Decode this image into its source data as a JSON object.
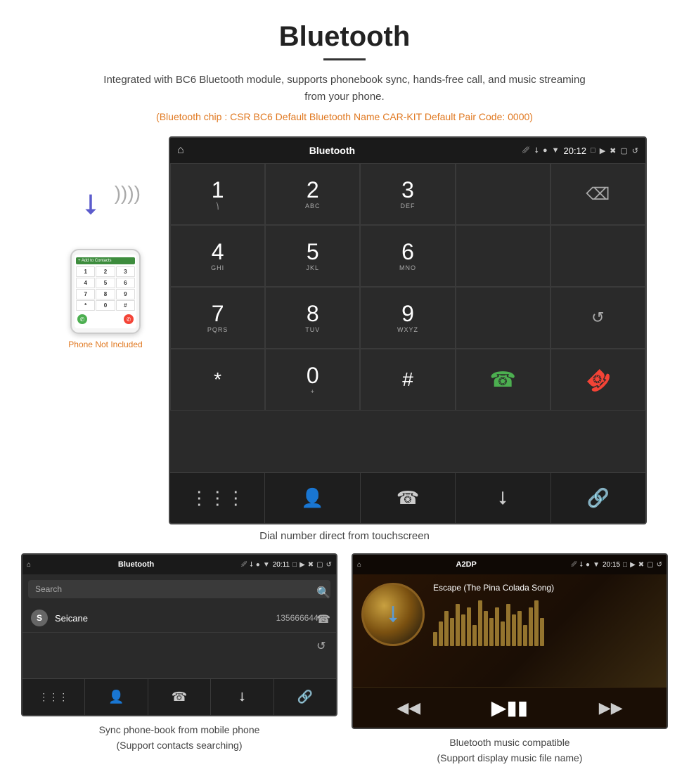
{
  "page": {
    "title": "Bluetooth",
    "description": "Integrated with BC6 Bluetooth module, supports phonebook sync, hands-free call, and music streaming from your phone.",
    "spec_line": "(Bluetooth chip : CSR BC6    Default Bluetooth Name CAR-KIT    Default Pair Code: 0000)",
    "dial_caption": "Dial number direct from touchscreen",
    "phonebook_caption_line1": "Sync phone-book from mobile phone",
    "phonebook_caption_line2": "(Support contacts searching)",
    "music_caption_line1": "Bluetooth music compatible",
    "music_caption_line2": "(Support display music file name)"
  },
  "dial_screen": {
    "status_title": "Bluetooth",
    "status_time": "20:12",
    "status_usb": "ψ",
    "keys": [
      {
        "main": "1",
        "sub": "⌓"
      },
      {
        "main": "2",
        "sub": "ABC"
      },
      {
        "main": "3",
        "sub": "DEF"
      },
      {
        "main": "",
        "sub": ""
      },
      {
        "main": "⌫",
        "sub": ""
      },
      {
        "main": "4",
        "sub": "GHI"
      },
      {
        "main": "5",
        "sub": "JKL"
      },
      {
        "main": "6",
        "sub": "MNO"
      },
      {
        "main": "",
        "sub": ""
      },
      {
        "main": "",
        "sub": ""
      },
      {
        "main": "7",
        "sub": "PQRS"
      },
      {
        "main": "8",
        "sub": "TUV"
      },
      {
        "main": "9",
        "sub": "WXYZ"
      },
      {
        "main": "",
        "sub": ""
      },
      {
        "main": "↺",
        "sub": ""
      },
      {
        "main": "*",
        "sub": ""
      },
      {
        "main": "0",
        "sub": "+"
      },
      {
        "main": "#",
        "sub": ""
      },
      {
        "main": "📞",
        "sub": ""
      },
      {
        "main": "📞",
        "sub": "end"
      }
    ],
    "nav_icons": [
      "⠿",
      "👤",
      "📞",
      "✱",
      "🔗"
    ]
  },
  "phonebook_screen": {
    "status_title": "Bluetooth",
    "status_time": "20:11",
    "search_placeholder": "Search",
    "contact_initial": "S",
    "contact_name": "Seicane",
    "contact_number": "13566664466",
    "side_icons": [
      "🔍",
      "📞",
      "↺"
    ],
    "nav_icons": [
      "⠿",
      "👤",
      "📞",
      "✱",
      "🔗"
    ]
  },
  "music_screen": {
    "status_title": "A2DP",
    "status_time": "20:15",
    "song_title": "Escape (The Pina Colada Song)",
    "viz_heights": [
      20,
      35,
      50,
      40,
      60,
      45,
      55,
      30,
      65,
      50,
      40,
      55,
      35,
      60,
      45,
      50,
      30,
      55,
      65,
      40
    ]
  },
  "phone_mock": {
    "contact_label": "+ Add to Contacts",
    "keys": [
      "1",
      "2",
      "3",
      "4",
      "5",
      "6",
      "7",
      "8",
      "9",
      "*",
      "0",
      "#"
    ],
    "not_included": "Phone Not Included"
  }
}
